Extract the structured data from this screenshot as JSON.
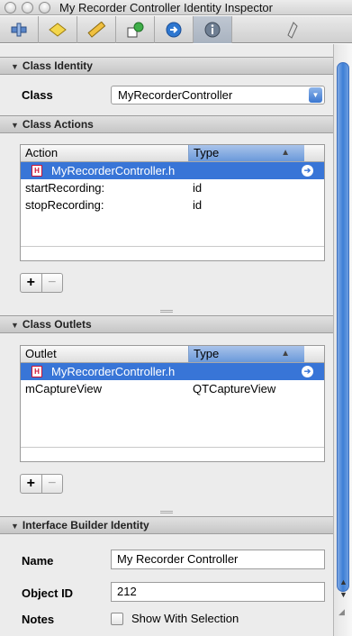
{
  "window": {
    "title": "My Recorder Controller Identity Inspector"
  },
  "toolbar": {
    "tabs": [
      {
        "icon": "attributes-icon"
      },
      {
        "icon": "effects-icon"
      },
      {
        "icon": "size-ruler-icon"
      },
      {
        "icon": "connections-icon"
      },
      {
        "icon": "bindings-arrow-icon"
      },
      {
        "icon": "identity-info-icon",
        "active": true
      },
      {
        "icon": "applescript-icon"
      }
    ]
  },
  "class_identity": {
    "header": "Class Identity",
    "class_label": "Class",
    "class_value": "MyRecorderController"
  },
  "class_actions": {
    "header": "Class Actions",
    "columns": [
      "Action",
      "Type"
    ],
    "file_row": "MyRecorderController.h",
    "rows": [
      {
        "name": "startRecording:",
        "type": "id"
      },
      {
        "name": "stopRecording:",
        "type": "id"
      }
    ],
    "add": "+",
    "remove": "−"
  },
  "class_outlets": {
    "header": "Class Outlets",
    "columns": [
      "Outlet",
      "Type"
    ],
    "file_row": "MyRecorderController.h",
    "rows": [
      {
        "name": "mCaptureView",
        "type": "QTCaptureView"
      }
    ],
    "add": "+",
    "remove": "−"
  },
  "ib_identity": {
    "header": "Interface Builder Identity",
    "name_label": "Name",
    "name_value": "My Recorder Controller",
    "object_id_label": "Object ID",
    "object_id_value": "212",
    "notes_label": "Notes",
    "show_with_selection": "Show With Selection",
    "show_with_selection_checked": false
  },
  "colors": {
    "selection": "#3875d7",
    "accent": "#3d7fd6"
  }
}
